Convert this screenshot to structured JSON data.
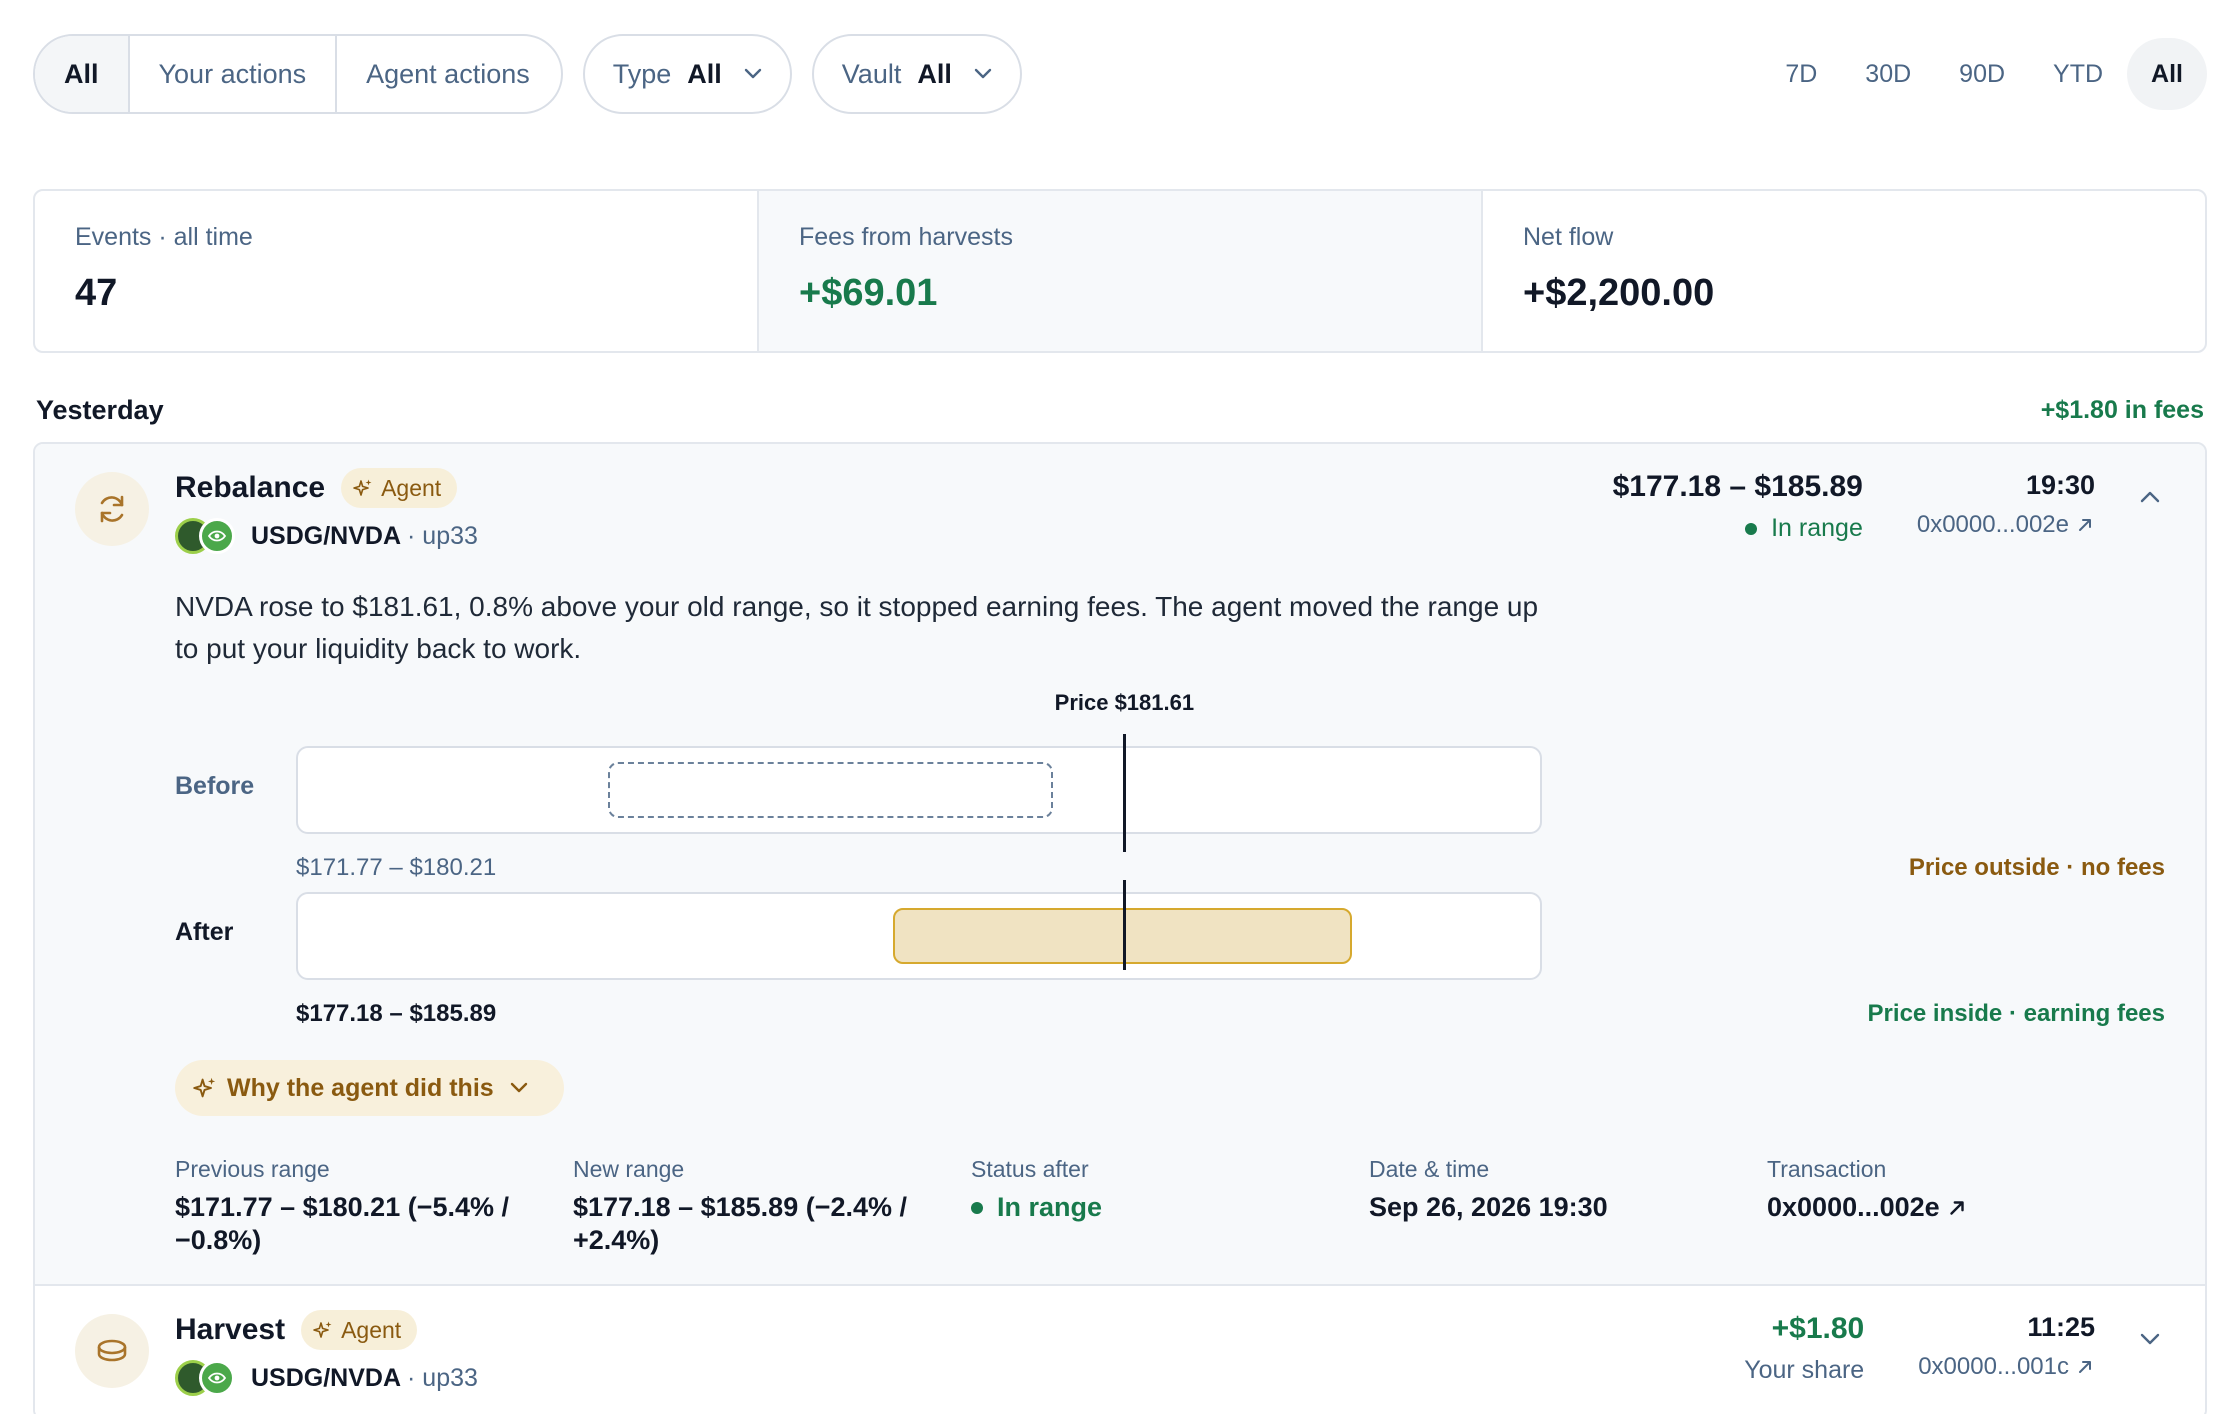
{
  "filters": {
    "segments": [
      {
        "label": "All",
        "active": true
      },
      {
        "label": "Your actions",
        "active": false
      },
      {
        "label": "Agent actions",
        "active": false
      }
    ],
    "type": {
      "label": "Type",
      "value": "All"
    },
    "vault": {
      "label": "Vault",
      "value": "All"
    },
    "periods": [
      {
        "label": "7D",
        "active": false
      },
      {
        "label": "30D",
        "active": false
      },
      {
        "label": "90D",
        "active": false
      },
      {
        "label": "YTD",
        "active": false
      },
      {
        "label": "All",
        "active": true
      }
    ]
  },
  "stats": [
    {
      "label": "Events · all time",
      "value": "47"
    },
    {
      "label": "Fees from harvests",
      "value": "+$69.01"
    },
    {
      "label": "Net flow",
      "value": "+$2,200.00"
    }
  ],
  "day": {
    "title": "Yesterday",
    "fees": "+$1.80 in fees"
  },
  "events": [
    {
      "title": "Rebalance",
      "badge": "Agent",
      "pair": "USDG/NVDA",
      "pair_sub": "· up33",
      "amount": "$177.18 – $185.89",
      "amount_sub": "In range",
      "time": "19:30",
      "tx": "0x0000...002e",
      "description": "NVDA rose to $181.61, 0.8% above your old range, so it stopped earning fees. The agent moved the range up to put your liquidity back to work.",
      "chart": {
        "price_label": "Price $181.61",
        "price": 181.61,
        "domain": [
          165.88,
          189.54
        ],
        "before": {
          "label": "Before",
          "range": [
            171.77,
            180.21
          ],
          "range_text": "$171.77 – $180.21",
          "status": "Price outside · no fees"
        },
        "after": {
          "label": "After",
          "range": [
            177.18,
            185.89
          ],
          "range_text": "$177.18 – $185.89",
          "status": "Price inside · earning fees"
        }
      },
      "why_label": "Why the agent did this",
      "details": [
        {
          "label": "Previous range",
          "value": "$171.77 – $180.21 (−5.4% / −0.8%)"
        },
        {
          "label": "New range",
          "value": "$177.18 – $185.89 (−2.4% / +2.4%)"
        },
        {
          "label": "Status after",
          "value": "In range"
        },
        {
          "label": "Date & time",
          "value": "Sep 26, 2026 19:30"
        },
        {
          "label": "Transaction",
          "value": "0x0000...002e"
        }
      ]
    },
    {
      "title": "Harvest",
      "badge": "Agent",
      "pair": "USDG/NVDA",
      "pair_sub": "· up33",
      "amount": "+$1.80",
      "amount_sub": "Your share",
      "time": "11:25",
      "tx": "0x0000...001c"
    }
  ],
  "colors": {
    "green": "#187a4c",
    "gold": "#8a5a10",
    "muted": "#4b6584"
  },
  "icons": [
    "rebalance-icon",
    "coin-stack-icon",
    "sparkle-icon",
    "chevron-down-icon",
    "chevron-up-icon",
    "external-link-icon"
  ]
}
